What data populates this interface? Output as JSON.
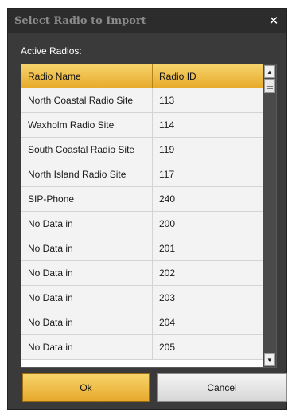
{
  "dialog": {
    "title": "Select Radio to Import",
    "close_glyph": "✕",
    "section_label": "Active Radios:"
  },
  "grid": {
    "columns": [
      "Radio Name",
      "Radio ID"
    ],
    "rows": [
      [
        "North Coastal Radio Site",
        "113"
      ],
      [
        "Waxholm Radio Site",
        "114"
      ],
      [
        "South Coastal Radio Site",
        "119"
      ],
      [
        "North Island Radio Site",
        "117"
      ],
      [
        "SIP-Phone",
        "240"
      ],
      [
        "No Data in",
        "200"
      ],
      [
        "No Data in",
        "201"
      ],
      [
        "No Data in",
        "202"
      ],
      [
        "No Data in",
        "203"
      ],
      [
        "No Data in",
        "204"
      ],
      [
        "No Data in",
        "205"
      ]
    ]
  },
  "scrollbar": {
    "up_icon": "▲",
    "down_icon": "▼"
  },
  "buttons": {
    "ok_label": "Ok",
    "cancel_label": "Cancel"
  },
  "colors": {
    "accent": "#e7aa2a",
    "dialog_bg": "#3a3a3a",
    "title_text": "#8a8a8a"
  }
}
